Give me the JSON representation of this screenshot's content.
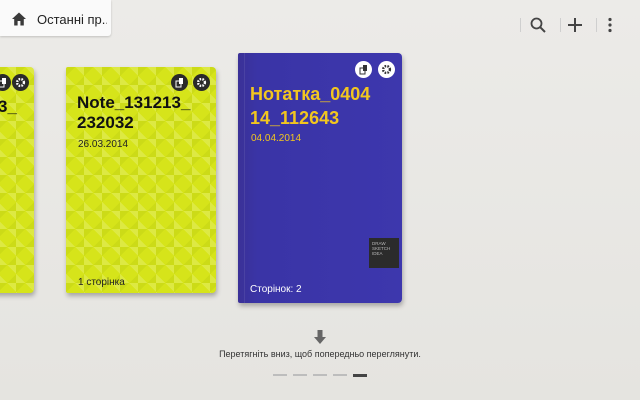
{
  "header": {
    "title": "Останні пр...",
    "home_icon": "home-icon"
  },
  "actions": [
    {
      "name": "search-icon"
    },
    {
      "name": "add-icon"
    },
    {
      "name": "overflow-menu-icon"
    }
  ],
  "notes": [
    {
      "title_line1": "",
      "title_line2": "3_",
      "date": "",
      "pages": "",
      "color": "#d6e41a"
    },
    {
      "title_line1": "Note_131213_",
      "title_line2": "232032",
      "date": "26.03.2014",
      "pages": "1 сторінка",
      "color": "#d6e41a"
    },
    {
      "title_line1": "Нотатка_0404",
      "title_line2": "14_112643",
      "date": "04.04.2014",
      "pages": "Сторінок: 2",
      "color": "#3b34a4",
      "title_color": "#f2c61f",
      "logo_text": "DRAW SKETCH IDEA"
    }
  ],
  "hint": {
    "text": "Перетягніть вниз, щоб попередньо переглянути."
  },
  "pager": {
    "count": 5,
    "active_index": 4
  }
}
